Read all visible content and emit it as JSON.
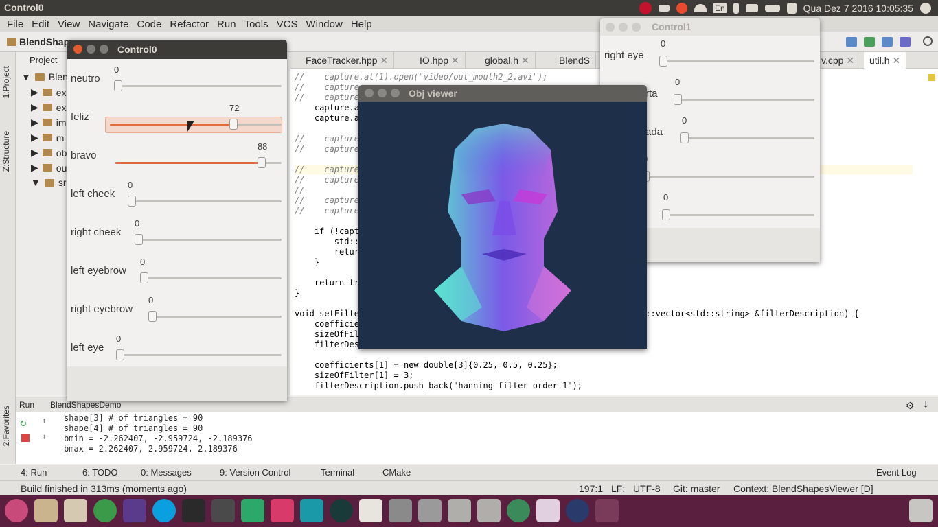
{
  "topbar": {
    "title": "Control0",
    "datetime": "Qua Dez  7 2016 10:05:35",
    "keyboard": "En"
  },
  "menu": [
    "File",
    "Edit",
    "View",
    "Navigate",
    "Code",
    "Refactor",
    "Run",
    "Tools",
    "VCS",
    "Window",
    "Help"
  ],
  "toolbar": {
    "project_name": "BlendShap",
    "file_hint": "util"
  },
  "project_panel": {
    "title": "Project",
    "root": "Blend",
    "items": [
      "ex",
      "ex",
      "im",
      "m",
      "ob",
      "ou",
      "sr"
    ]
  },
  "left_tabs": [
    "1:Project",
    "Z:Structure",
    "2:Favorites"
  ],
  "editor_tabs": [
    "FaceTracker.hpp",
    "IO.hpp",
    "global.h",
    "BlendS",
    "v.cpp",
    "util.h"
  ],
  "code_lines": [
    {
      "t": "//    capture.at(1).open(\"video/out_mouth2_2.avi\");",
      "c": "comment"
    },
    {
      "t": "//    capture",
      "c": "comment"
    },
    {
      "t": "//    capture",
      "c": "comment"
    },
    {
      "t": "    capture.at",
      "c": ""
    },
    {
      "t": "    capture.at",
      "c": ""
    },
    {
      "t": "",
      "c": ""
    },
    {
      "t": "//    capture",
      "c": "comment"
    },
    {
      "t": "//    capture",
      "c": "comment"
    },
    {
      "t": "",
      "c": ""
    },
    {
      "t": "//    capture",
      "c": "comment hl"
    },
    {
      "t": "//    capture",
      "c": "comment"
    },
    {
      "t": "//",
      "c": "comment"
    },
    {
      "t": "//    capture",
      "c": "comment"
    },
    {
      "t": "//    capture",
      "c": "comment"
    },
    {
      "t": "",
      "c": ""
    },
    {
      "t": "    if (!captu",
      "c": ""
    },
    {
      "t": "        std::c",
      "c": ""
    },
    {
      "t": "        retur",
      "c": ""
    },
    {
      "t": "    }",
      "c": ""
    },
    {
      "t": "",
      "c": ""
    },
    {
      "t": "    return tru",
      "c": ""
    },
    {
      "t": "}",
      "c": ""
    },
    {
      "t": "",
      "c": ""
    },
    {
      "t": "void setFilte",
      "c": ""
    },
    {
      "t": "    coefficien",
      "c": ""
    },
    {
      "t": "    sizeOfFilt",
      "c": ""
    },
    {
      "t": "    filterDesc",
      "c": ""
    },
    {
      "t": "",
      "c": ""
    },
    {
      "t": "    coefficients[1] = new double[3]{0.25, 0.5, 0.25};",
      "c": ""
    },
    {
      "t": "    sizeOfFilter[1] = 3;",
      "c": ""
    },
    {
      "t": "    filterDescription.push_back(\"hanning filter order 1\");",
      "c": ""
    }
  ],
  "code_right": "d::vector<std::string> &filterDescription) {",
  "run": {
    "label": "Run",
    "config": "BlendShapesDemo",
    "output": [
      "shape[3] # of triangles = 90",
      "shape[4] # of triangles = 90",
      "bmin = -2.262407, -2.959724, -2.189376",
      "bmax = 2.262407, 2.959724, 2.189376"
    ]
  },
  "bottom_tabs": [
    {
      "label": "4: Run"
    },
    {
      "label": "6: TODO"
    },
    {
      "label": "0: Messages"
    },
    {
      "label": "9: Version Control"
    },
    {
      "label": "Terminal"
    },
    {
      "label": "CMake"
    }
  ],
  "event_log": "Event Log",
  "status": {
    "message": "Build finished in 313ms (moments ago)",
    "position": "197:1",
    "line_sep": "LF:",
    "encoding": "UTF-8",
    "git": "Git: master",
    "context": "Context: BlendShapesViewer [D]"
  },
  "control0": {
    "title": "Control0",
    "sliders": [
      {
        "name": "neutro",
        "value": 0,
        "max": 100
      },
      {
        "name": "feliz",
        "value": 72,
        "max": 100
      },
      {
        "name": "bravo",
        "value": 88,
        "max": 100
      },
      {
        "name": "left cheek",
        "value": 0,
        "max": 100
      },
      {
        "name": "right cheek",
        "value": 0,
        "max": 100
      },
      {
        "name": "left eyebrow",
        "value": 0,
        "max": 100
      },
      {
        "name": "right eyebrow",
        "value": 0,
        "max": 100
      },
      {
        "name": "left eye",
        "value": 0,
        "max": 100
      }
    ]
  },
  "control1": {
    "title": "Control1",
    "sliders": [
      {
        "name": "right eye",
        "value": 0
      },
      {
        "name": "rta",
        "value": 0
      },
      {
        "name": "ada",
        "value": 0
      },
      {
        "name": "",
        "value": 0
      },
      {
        "name": "",
        "value": 0
      }
    ]
  },
  "objviewer": {
    "title": "Obj viewer"
  },
  "colors": {
    "accent": "#e16a3f",
    "dock": "#5a1f3f",
    "viewer_bg": "#1e2f4a"
  }
}
